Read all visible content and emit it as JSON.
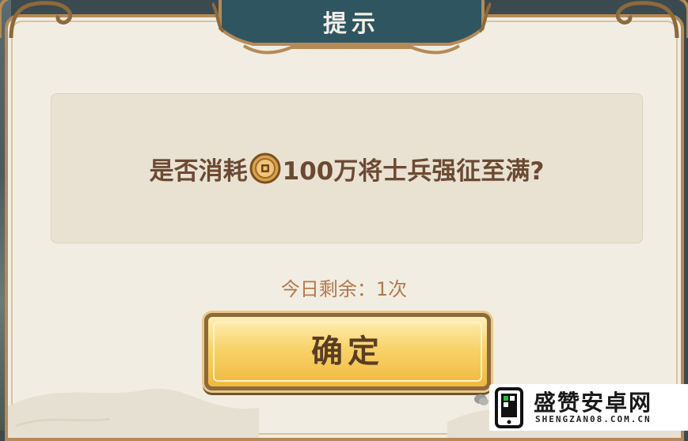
{
  "dialog": {
    "title": "提示",
    "message_before_icon": "是否消耗",
    "currency_icon": "coin-icon",
    "message_after_icon": "100万将士兵强征至满?",
    "remaining_label": "今日剩余：1次",
    "confirm_label": "确定"
  },
  "watermark": {
    "title": "盛赞安卓网",
    "subtitle": "SHENGZAN08.COM.CN"
  },
  "colors": {
    "panel": "#f1ede2",
    "frame": "#b48a57",
    "title_banner": "#2f5560",
    "text_brown": "#6b4a33",
    "remaining_text": "#b3794c",
    "button_gold": "#f8d36a"
  }
}
